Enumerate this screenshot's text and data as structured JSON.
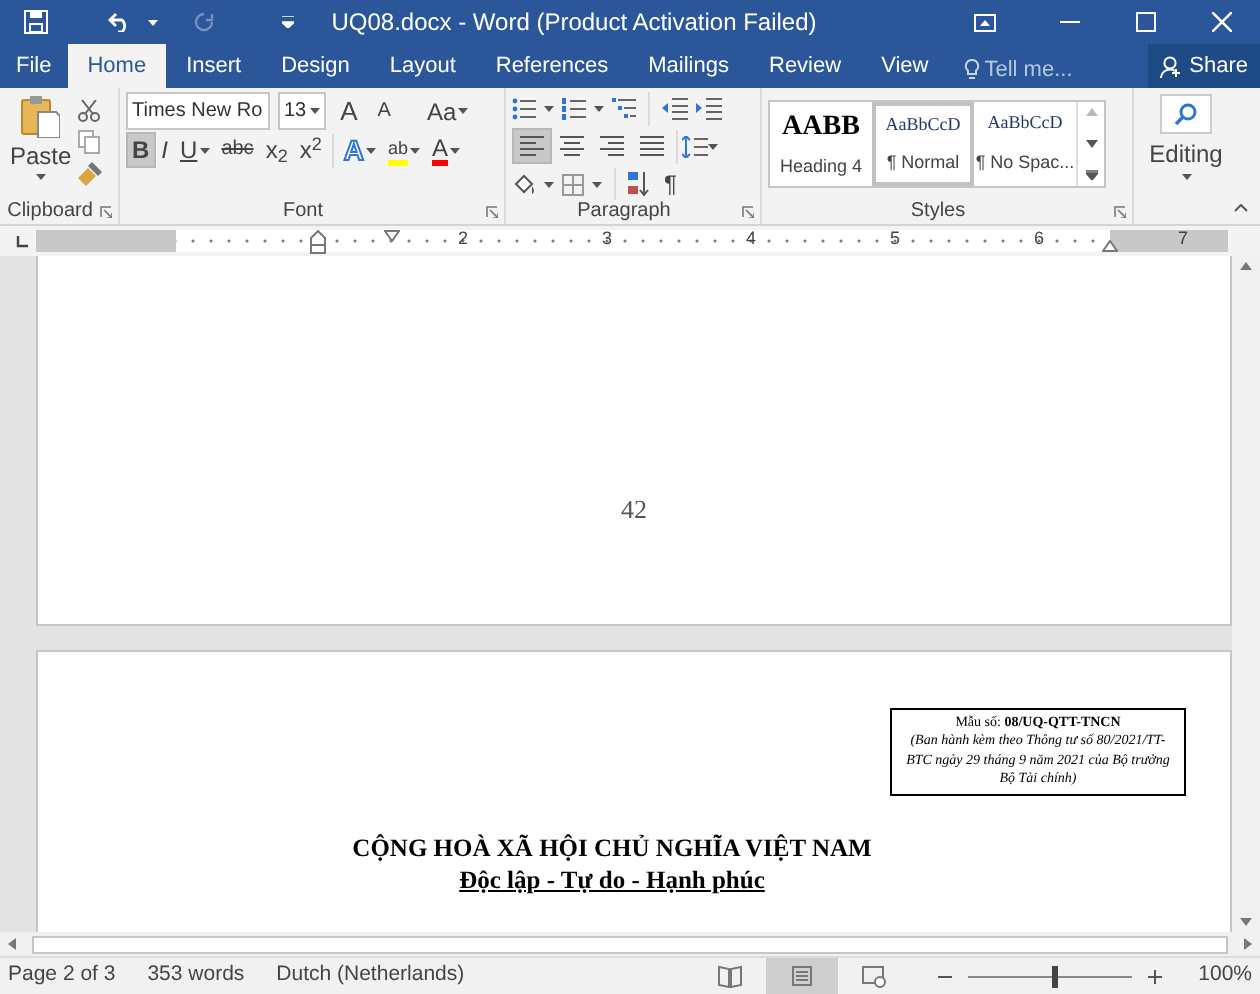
{
  "title_bar": {
    "title": "UQ08.docx - Word (Product Activation Failed)",
    "redo_disabled": true
  },
  "tabs": [
    {
      "label": "File",
      "selected": false
    },
    {
      "label": "Home",
      "selected": true
    },
    {
      "label": "Insert",
      "selected": false
    },
    {
      "label": "Design",
      "selected": false
    },
    {
      "label": "Layout",
      "selected": false
    },
    {
      "label": "References",
      "selected": false
    },
    {
      "label": "Mailings",
      "selected": false
    },
    {
      "label": "Review",
      "selected": false
    },
    {
      "label": "View",
      "selected": false
    }
  ],
  "tell_me": {
    "placeholder": "Tell me..."
  },
  "share_button": "Share",
  "ribbon": {
    "clipboard": {
      "paste_label": "Paste",
      "group_label": "Clipboard"
    },
    "font": {
      "font_name": "Times New Ro",
      "font_size": "13",
      "group_label": "Font",
      "size_tools": [
        {
          "label": "A",
          "kind": "grow"
        },
        {
          "label": "A",
          "kind": "shrink"
        },
        {
          "label": "Aa",
          "kind": "case"
        }
      ],
      "format_tools": [
        {
          "label": "B",
          "kind": "bold",
          "selected": true
        },
        {
          "label": "I",
          "kind": "italic",
          "selected": false
        },
        {
          "label": "U",
          "kind": "underline",
          "selected": false
        },
        {
          "label": "abc",
          "kind": "strike",
          "selected": false
        },
        {
          "label": "x$_{2}$",
          "kind": "subscript",
          "selected": false
        },
        {
          "label": "x$^{2}$",
          "kind": "superscript",
          "selected": false
        }
      ],
      "color_tools": [
        {
          "label": "A",
          "kind": "effects"
        },
        {
          "label": "ab",
          "kind": "highlight",
          "color": "#ffff00"
        },
        {
          "label": "A",
          "kind": "color",
          "color": "#ff0000"
        }
      ]
    },
    "paragraph": {
      "group_label": "Paragraph",
      "alignments": [
        {
          "kind": "left",
          "selected": true
        },
        {
          "kind": "center",
          "selected": false
        },
        {
          "kind": "right",
          "selected": false
        },
        {
          "kind": "justify",
          "selected": false
        }
      ],
      "marks_label": "¶"
    },
    "styles": {
      "group_label": "Styles",
      "items": [
        {
          "sample": "AABB",
          "name": "Heading 4",
          "kind": "heading",
          "selected": false
        },
        {
          "sample": "AaBbCcD",
          "name": "¶ Normal",
          "kind": "body",
          "selected": true
        },
        {
          "sample": "AaBbCcD",
          "name": "¶ No Spac...",
          "kind": "body",
          "selected": false
        }
      ]
    },
    "editing": {
      "label": "Editing"
    }
  },
  "ruler": {
    "numbers": [
      "2",
      "3",
      "4",
      "5",
      "6",
      "7"
    ]
  },
  "document": {
    "page_number": "42",
    "form_box": [
      "Mẫu số: **08/UQ-QTT-TNCN**",
      "*(Ban hành kèm theo Thông tư số 80/2021/TT-BTC ngày 29 tháng 9 năm 2021 của Bộ trưởng Bộ Tài chính)*"
    ],
    "heading": "CỘNG HOÀ XÃ HỘI CHỦ NGHĨA VIỆT NAM",
    "subheading": "Độc lập - Tự do - Hạnh phúc"
  },
  "status_bar": {
    "page": "Page 2 of 3",
    "words": "353 words",
    "language": "Dutch (Netherlands)",
    "views": [
      {
        "kind": "read",
        "selected": false
      },
      {
        "kind": "print",
        "selected": true
      },
      {
        "kind": "web",
        "selected": false
      }
    ],
    "zoom": {
      "level": 0.52,
      "reading": "100%"
    }
  }
}
